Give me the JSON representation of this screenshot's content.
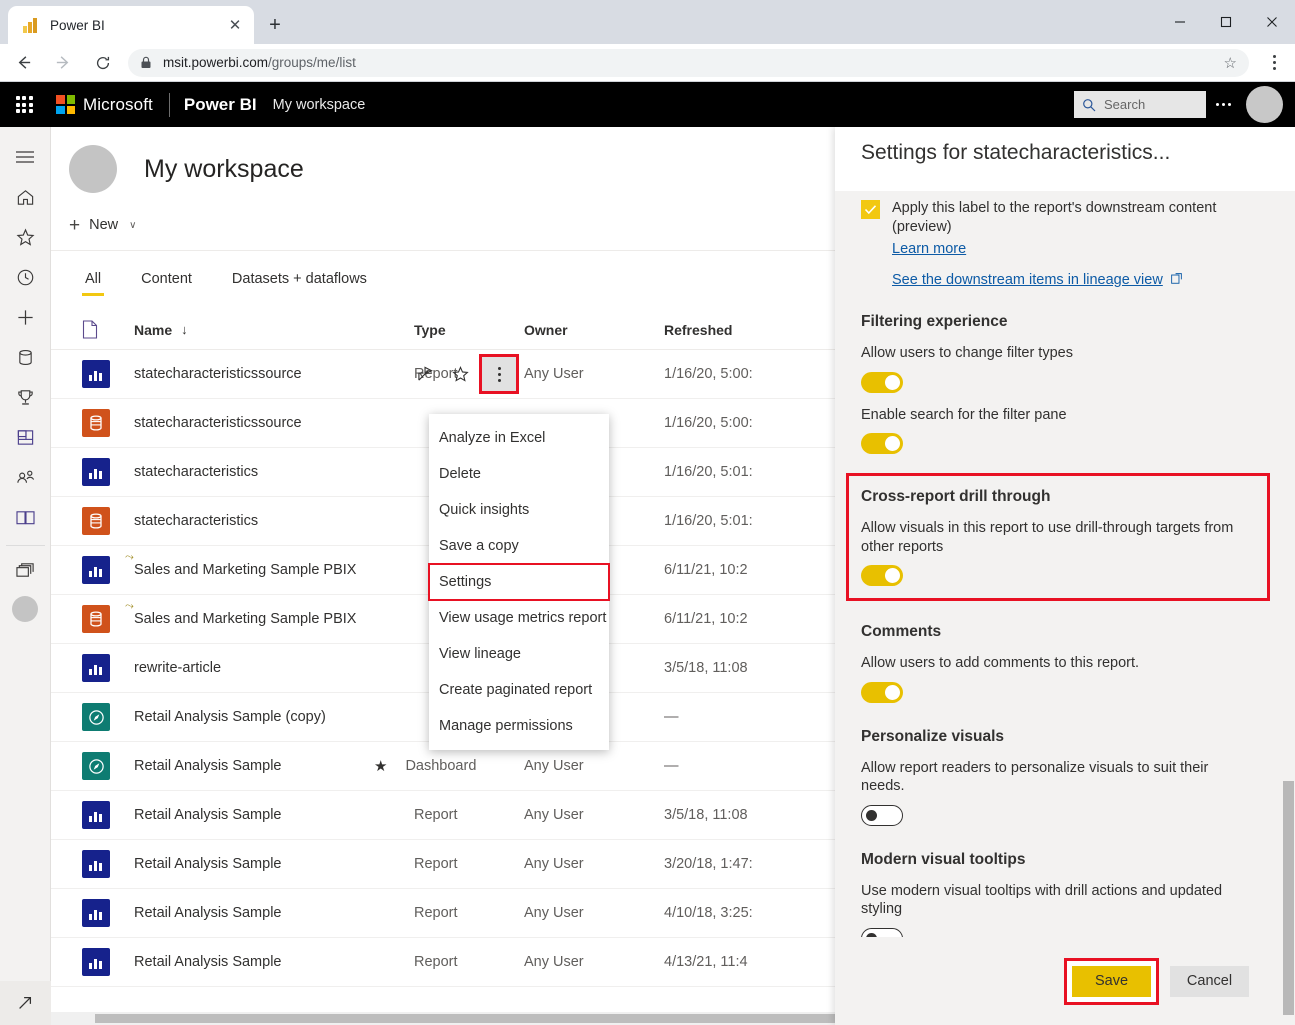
{
  "browser": {
    "tab_title": "Power BI",
    "tab_favicon": "powerbi-icon",
    "close_label": "✕",
    "newtab_label": "+",
    "url_prefix": "msit.powerbi.com",
    "url_suffix": "/groups/me/list",
    "lock_icon": "lock-icon",
    "star_icon": "☆",
    "back_icon": "back-arrow-icon",
    "forward_icon": "forward-arrow-icon",
    "reload_icon": "reload-icon",
    "menu_icon": "browser-menu-icon",
    "minimize": "minimize-icon",
    "maximize": "maximize-icon",
    "close": "close-icon"
  },
  "topbar": {
    "waffle": "app-launcher-icon",
    "microsoft": "Microsoft",
    "product": "Power BI",
    "breadcrumb": "My workspace",
    "search_placeholder": "Search",
    "search_icon": "search-icon",
    "more_icon": "more-options-icon",
    "avatar": "user-avatar"
  },
  "rail": {
    "items": [
      {
        "name": "hamburger-icon",
        "label": "Navigation"
      },
      {
        "name": "home-icon",
        "label": "Home"
      },
      {
        "name": "star-icon",
        "label": "Favorites"
      },
      {
        "name": "clock-icon",
        "label": "Recent"
      },
      {
        "name": "plus-icon",
        "label": "Create"
      },
      {
        "name": "database-icon",
        "label": "Datasets"
      },
      {
        "name": "trophy-icon",
        "label": "Goals"
      },
      {
        "name": "apps-icon",
        "label": "Apps"
      },
      {
        "name": "people-icon",
        "label": "Shared with me"
      },
      {
        "name": "book-icon",
        "label": "Learn"
      },
      {
        "name": "workspaces-icon",
        "label": "Workspaces"
      }
    ],
    "avatar": "workspace-avatar",
    "bottom_icon": "expand-arrow-icon"
  },
  "workspace": {
    "avatar": "workspace-avatar",
    "title": "My workspace",
    "new_label": "New",
    "new_plus": "+",
    "new_chevron": "∨",
    "tabs": [
      {
        "label": "All",
        "active": true
      },
      {
        "label": "Content",
        "active": false
      },
      {
        "label": "Datasets + dataflows",
        "active": false
      }
    ],
    "columns": {
      "icon": "",
      "name": "Name",
      "sort_arrow": "↓",
      "type": "Type",
      "owner": "Owner",
      "refreshed": "Refreshed"
    },
    "rows": [
      {
        "icon": "report",
        "name": "statecharacteristicssource",
        "refresh_flag": false,
        "type": "Report",
        "owner": "Any User",
        "refreshed": "1/16/20, 5:00:",
        "selected": true,
        "star": false
      },
      {
        "icon": "dataset",
        "name": "statecharacteristicssource",
        "refresh_flag": false,
        "type": "",
        "owner": "Any User",
        "refreshed": "1/16/20, 5:00:",
        "selected": false,
        "star": false
      },
      {
        "icon": "report",
        "name": "statecharacteristics",
        "refresh_flag": false,
        "type": "",
        "owner": "Any User",
        "refreshed": "1/16/20, 5:01:",
        "selected": false,
        "star": false
      },
      {
        "icon": "dataset",
        "name": "statecharacteristics",
        "refresh_flag": false,
        "type": "",
        "owner": "Any User",
        "refreshed": "1/16/20, 5:01:",
        "selected": false,
        "star": false
      },
      {
        "icon": "report",
        "name": "Sales and Marketing Sample PBIX",
        "refresh_flag": true,
        "type": "",
        "owner": "Any User",
        "refreshed": "6/11/21, 10:2",
        "selected": false,
        "star": false
      },
      {
        "icon": "dataset",
        "name": "Sales and Marketing Sample PBIX",
        "refresh_flag": true,
        "type": "",
        "owner": "Any User",
        "refreshed": "6/11/21, 10:2",
        "selected": false,
        "star": false
      },
      {
        "icon": "report",
        "name": "rewrite-article",
        "refresh_flag": false,
        "type": "",
        "owner": "Any User",
        "refreshed": "3/5/18, 11:08",
        "selected": false,
        "star": false
      },
      {
        "icon": "dashboard",
        "name": "Retail Analysis Sample (copy)",
        "refresh_flag": false,
        "type": "",
        "owner": "Any User",
        "refreshed": "—",
        "selected": false,
        "star": false
      },
      {
        "icon": "dashboard",
        "name": "Retail Analysis Sample",
        "refresh_flag": false,
        "type": "Dashboard",
        "owner": "Any User",
        "refreshed": "—",
        "selected": false,
        "star": true
      },
      {
        "icon": "report",
        "name": "Retail Analysis Sample",
        "refresh_flag": false,
        "type": "Report",
        "owner": "Any User",
        "refreshed": "3/5/18, 11:08",
        "selected": false,
        "star": false
      },
      {
        "icon": "report",
        "name": "Retail Analysis Sample",
        "refresh_flag": false,
        "type": "Report",
        "owner": "Any User",
        "refreshed": "3/20/18, 1:47:",
        "selected": false,
        "star": false
      },
      {
        "icon": "report",
        "name": "Retail Analysis Sample",
        "refresh_flag": false,
        "type": "Report",
        "owner": "Any User",
        "refreshed": "4/10/18, 3:25:",
        "selected": false,
        "star": false
      },
      {
        "icon": "report",
        "name": "Retail Analysis Sample",
        "refresh_flag": false,
        "type": "Report",
        "owner": "Any User",
        "refreshed": "4/13/21, 11:4",
        "selected": false,
        "star": false
      }
    ],
    "row_actions": {
      "share_icon": "share-icon",
      "favorite_icon": "favorite-star-icon",
      "more_icon": "more-options-icon"
    }
  },
  "context_menu": {
    "items": [
      {
        "label": "Analyze in Excel",
        "highlighted": false
      },
      {
        "label": "Delete",
        "highlighted": false
      },
      {
        "label": "Quick insights",
        "highlighted": false
      },
      {
        "label": "Save a copy",
        "highlighted": false
      },
      {
        "label": "Settings",
        "highlighted": true
      },
      {
        "label": "View usage metrics report",
        "highlighted": false
      },
      {
        "label": "View lineage",
        "highlighted": false
      },
      {
        "label": "Create paginated report",
        "highlighted": false
      },
      {
        "label": "Manage permissions",
        "highlighted": false
      }
    ]
  },
  "settings_panel": {
    "title": "Settings for statecharacteristics...",
    "label_checkbox": {
      "checked": true,
      "label": "Apply this label to the report's downstream content (preview)",
      "learn_more": "Learn more",
      "lineage_link": "See the downstream items in lineage view",
      "external_icon": "external-link-icon"
    },
    "sections": [
      {
        "title": "Filtering experience",
        "boxed": false,
        "items": [
          {
            "desc": "Allow users to change filter types",
            "toggle": "on"
          },
          {
            "desc": "Enable search for the filter pane",
            "toggle": "on"
          }
        ]
      },
      {
        "title": "Cross-report drill through",
        "boxed": true,
        "items": [
          {
            "desc": "Allow visuals in this report to use drill-through targets from other reports",
            "toggle": "on"
          }
        ]
      },
      {
        "title": "Comments",
        "boxed": false,
        "items": [
          {
            "desc": "Allow users to add comments to this report.",
            "toggle": "on"
          }
        ]
      },
      {
        "title": "Personalize visuals",
        "boxed": false,
        "items": [
          {
            "desc": "Allow report readers to personalize visuals to suit their needs.",
            "toggle": "off"
          }
        ]
      },
      {
        "title": "Modern visual tooltips",
        "boxed": false,
        "items": [
          {
            "desc": "Use modern visual tooltips with drill actions and updated styling",
            "toggle": "off"
          }
        ]
      }
    ],
    "save_label": "Save",
    "cancel_label": "Cancel"
  },
  "colors": {
    "accent_yellow": "#f2c811",
    "toggle_on": "#e8c000",
    "highlight_red": "#e81123",
    "report_blue": "#16228c",
    "dataset_orange": "#d0521b",
    "dashboard_teal": "#0e7c72",
    "link_blue": "#0d5ba6"
  }
}
